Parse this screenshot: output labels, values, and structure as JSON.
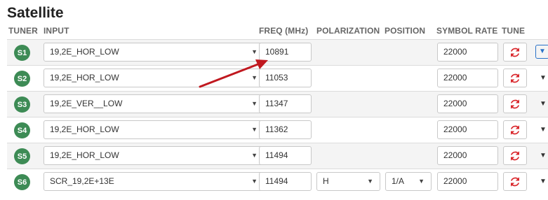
{
  "page": {
    "title": "Satellite"
  },
  "headers": {
    "tuner": "TUNER",
    "input": "INPUT",
    "freq": "FREQ (MHz)",
    "polarization": "POLARIZATION",
    "position": "POSITION",
    "symbol_rate": "SYMBOL RATE",
    "tune": "TUNE"
  },
  "rows": [
    {
      "tuner": "S1",
      "input": "19,2E_HOR_LOW",
      "freq": "10891",
      "polarization": "",
      "position": "",
      "symbol_rate": "22000"
    },
    {
      "tuner": "S2",
      "input": "19,2E_HOR_LOW",
      "freq": "11053",
      "polarization": "",
      "position": "",
      "symbol_rate": "22000"
    },
    {
      "tuner": "S3",
      "input": "19,2E_VER__LOW",
      "freq": "11347",
      "polarization": "",
      "position": "",
      "symbol_rate": "22000"
    },
    {
      "tuner": "S4",
      "input": "19,2E_HOR_LOW",
      "freq": "11362",
      "polarization": "",
      "position": "",
      "symbol_rate": "22000"
    },
    {
      "tuner": "S5",
      "input": "19,2E_HOR_LOW",
      "freq": "11494",
      "polarization": "",
      "position": "",
      "symbol_rate": "22000"
    },
    {
      "tuner": "S6",
      "input": "SCR_19,2E+13E",
      "freq": "11494",
      "polarization": "H",
      "position": "1/A",
      "symbol_rate": "22000"
    }
  ],
  "icons": {
    "tune": "refresh-icon",
    "more": "caret-down-icon",
    "select": "caret-down-icon"
  },
  "colors": {
    "badge": "#3d8b55",
    "tune_icon": "#d9262b",
    "arrow": "#c0181f",
    "focus": "#2a72c8"
  }
}
